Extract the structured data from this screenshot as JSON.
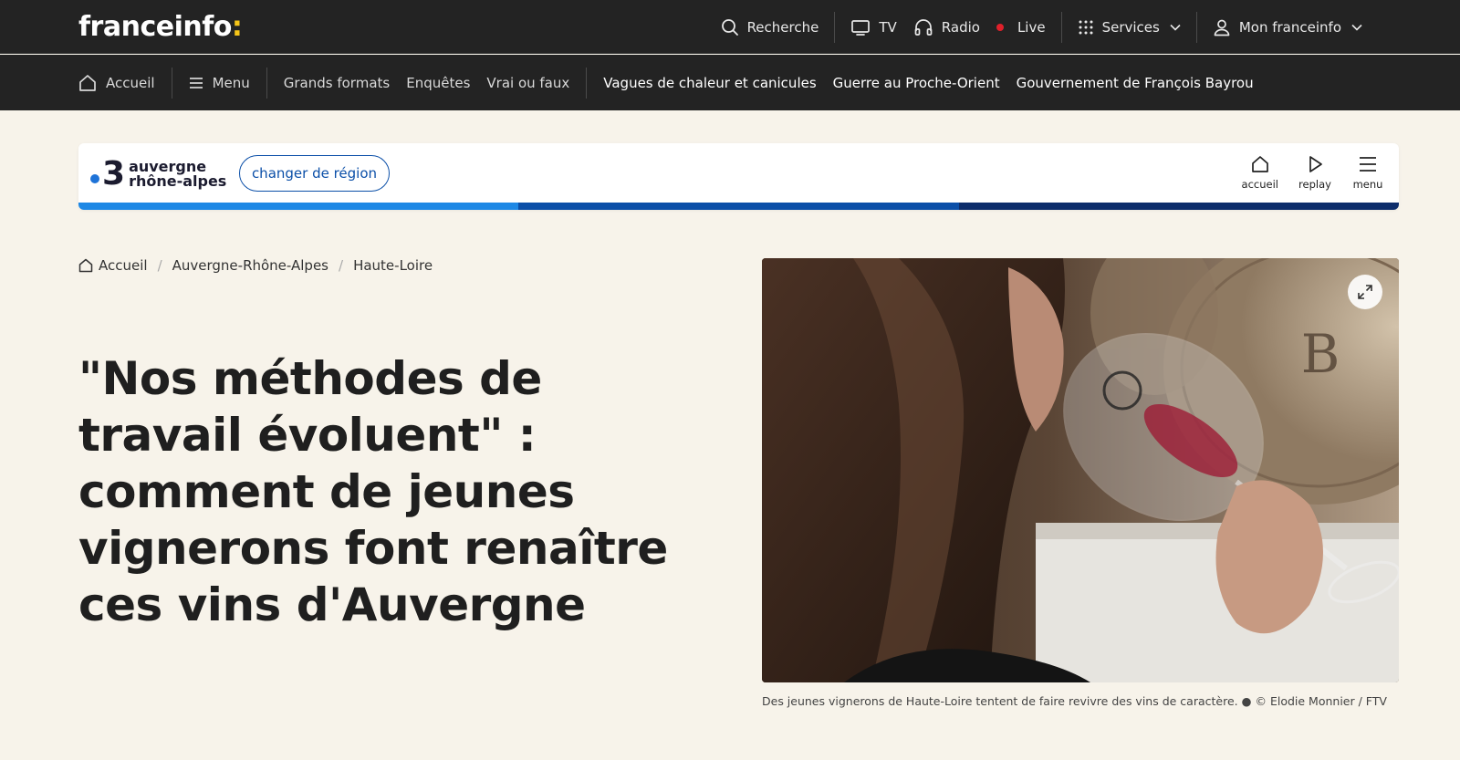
{
  "top": {
    "logo_text": "franceinfo",
    "logo_colon": ":",
    "search": "Recherche",
    "tv": "TV",
    "radio": "Radio",
    "live": "Live",
    "services": "Services",
    "account": "Mon franceinfo"
  },
  "nav": {
    "home": "Accueil",
    "menu": "Menu",
    "items": [
      "Grands formats",
      "Enquêtes",
      "Vrai ou faux"
    ],
    "topics": [
      "Vagues de chaleur et canicules",
      "Guerre au Proche-Orient",
      "Gouvernement de François Bayrou"
    ]
  },
  "region": {
    "channel_number": "3",
    "name_line1": "auvergne",
    "name_line2": "rhône-alpes",
    "change_label": "changer de région",
    "actions": [
      "accueil",
      "replay",
      "menu"
    ],
    "strip_colors": [
      "#1e88e5",
      "#0b4fa8",
      "#0d2d6b"
    ]
  },
  "breadcrumb": [
    "Accueil",
    "Auvergne-Rhône-Alpes",
    "Haute-Loire"
  ],
  "article": {
    "title": "\"Nos méthodes de travail évoluent\" : comment de jeunes vignerons font renaître ces vins d'Auvergne",
    "caption": "Des jeunes vignerons de Haute-Loire tentent de faire revivre des vins de caractère. ● © Elodie Monnier / FTV"
  },
  "colors": {
    "topbar": "#232323",
    "page_bg": "#f7f3ea",
    "accent_blue": "#0b4fa8",
    "live_red": "#e0202a",
    "logo_colon": "#f5c518"
  }
}
